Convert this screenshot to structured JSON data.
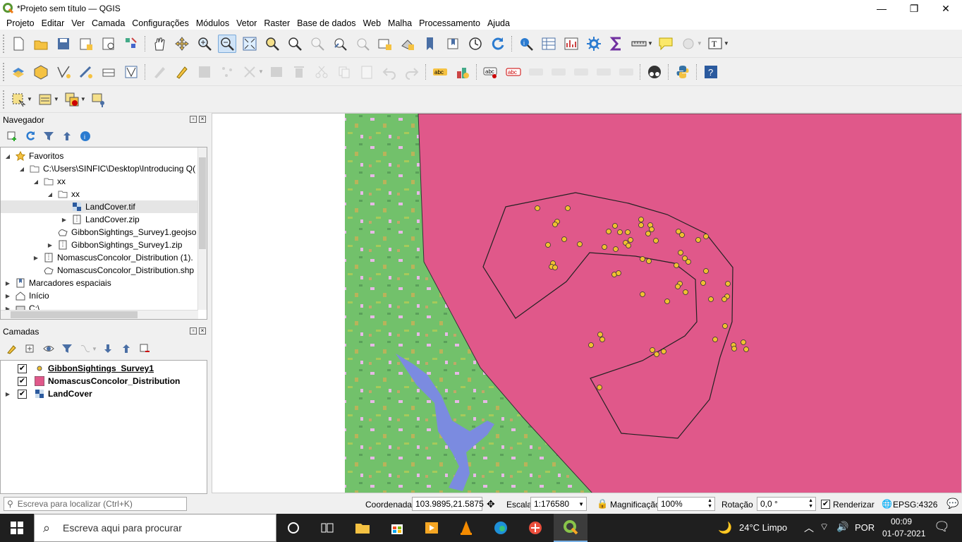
{
  "window": {
    "title": "*Projeto sem título — QGIS",
    "minimize": "—",
    "maximize": "❐",
    "close": "✕"
  },
  "menu": [
    "Projeto",
    "Editar",
    "Ver",
    "Camada",
    "Configurações",
    "Módulos",
    "Vetor",
    "Raster",
    "Base de dados",
    "Web",
    "Malha",
    "Processamento",
    "Ajuda"
  ],
  "browser": {
    "title": "Navegador",
    "items": {
      "favoritos": "Favoritos",
      "path": "C:\\Users\\SINFIC\\Desktop\\Introducing Q(",
      "xx1": "xx",
      "xx2": "xx",
      "landcover_tif": "LandCover.tif",
      "landcover_zip": "LandCover.zip",
      "gibbon_geojson": "GibbonSightings_Survey1.geojso",
      "gibbon_zip": "GibbonSightings_Survey1.zip",
      "nomascus_zip": "NomascusConcolor_Distribution (1).",
      "nomascus_shp": "NomascusConcolor_Distribution.shp",
      "marcadores": "Marcadores espaciais",
      "inicio": "Início",
      "c_drive": "C:\\"
    }
  },
  "layers": {
    "title": "Camadas",
    "items": [
      {
        "name": "GibbonSightings_Survey1",
        "checked": true
      },
      {
        "name": "NomascusConcolor_Distribution",
        "checked": true
      },
      {
        "name": "LandCover",
        "checked": true
      }
    ]
  },
  "status": {
    "locator_placeholder": "Escreva para localizar (Ctrl+K)",
    "coord_label": "Coordenada",
    "coord_value": "103.9895,21.5875",
    "scale_label": "Escala",
    "scale_value": "1:176580",
    "magnifier_label": "Magnificação",
    "magnifier_value": "100%",
    "rotation_label": "Rotação",
    "rotation_value": "0,0 °",
    "render_label": "Renderizar",
    "render_checked": true,
    "crs": "EPSG:4326"
  },
  "taskbar": {
    "search_placeholder": "Escreva aqui para procurar",
    "weather": "24°C  Limpo",
    "language": "POR",
    "time": "00:09",
    "date": "01-07-2021"
  },
  "colors": {
    "polygon_fill": "#e0588a",
    "landcover_green": "#72c16b",
    "water": "#7b8be0",
    "point_fill": "#f0c030"
  }
}
